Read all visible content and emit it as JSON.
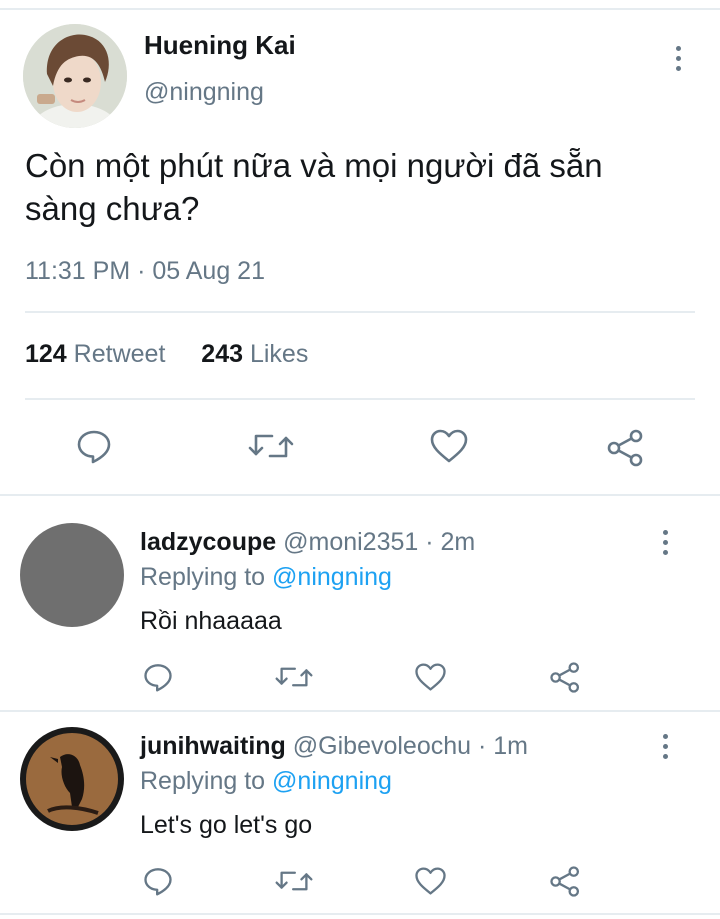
{
  "tweet": {
    "author_name": "Huening Kai",
    "author_handle": "@ningning",
    "text": "Còn một phút nữa và mọi người đã sẵn sàng chưa?",
    "timestamp": "11:31 PM · 05 Aug 21",
    "retweet_count": "124",
    "retweet_label": "Retweet",
    "like_count": "243",
    "like_label": "Likes"
  },
  "actions": {
    "reply_icon": "comment-icon",
    "retweet_icon": "retweet-icon",
    "like_icon": "heart-icon",
    "share_icon": "share-icon",
    "more_icon": "more-vertical-icon"
  },
  "replies": [
    {
      "name": "ladzycoupe",
      "handle": "@moni2351",
      "time": "· 2m",
      "replying_prefix": "Replying to",
      "replying_to": "@ningning",
      "text": "Rồi nhaaaaa"
    },
    {
      "name": "junihwaiting",
      "handle": "@Gibevoleochu",
      "time": "· 1m",
      "replying_prefix": "Replying to",
      "replying_to": "@ningning",
      "text": "Let's go let's go"
    }
  ],
  "colors": {
    "text": "#14171a",
    "muted": "#657786",
    "link": "#1da1f2",
    "divider": "#e6ecf0"
  }
}
